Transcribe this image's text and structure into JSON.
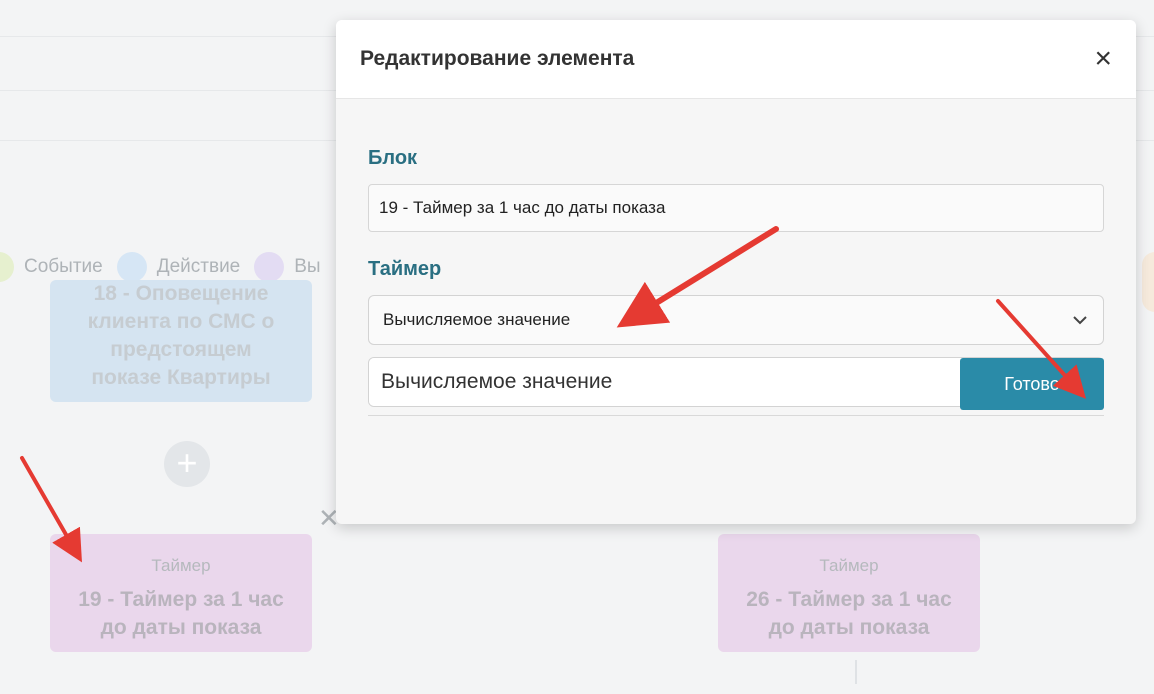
{
  "background": {
    "legend": [
      {
        "label": "Событие",
        "color": "#e6f0cf"
      },
      {
        "label": "Действие",
        "color": "#d6e6f5"
      },
      {
        "label": "Вы",
        "color": "#e3dcf3"
      }
    ],
    "node_sms_lines": [
      "18 - Оповещение",
      "клиента по СМС о",
      "предстоящем",
      "показе Квартиры"
    ],
    "node_timer_left": {
      "kind": "Таймер",
      "lines": [
        "19 - Таймер за 1 час",
        "до даты показа"
      ]
    },
    "node_timer_right": {
      "kind": "Таймер",
      "lines": [
        "26 - Таймер за 1 час",
        "до даты показа"
      ]
    },
    "plus_glyph": "+",
    "remove_glyph": "✕"
  },
  "modal": {
    "title": "Редактирование элемента",
    "close_glyph": "×",
    "block_label": "Блок",
    "block_value": "19 - Таймер за 1 час до даты показа",
    "timer_label": "Таймер",
    "timer_select_value": "Вычисляемое значение",
    "timer_input_value": "Вычисляемое значение",
    "tool_icon": "hammer-icon",
    "done_label": "Готово"
  },
  "colors": {
    "accent": "#2a8ba8",
    "label": "#2a6f82",
    "arrow": "#e53a32"
  }
}
